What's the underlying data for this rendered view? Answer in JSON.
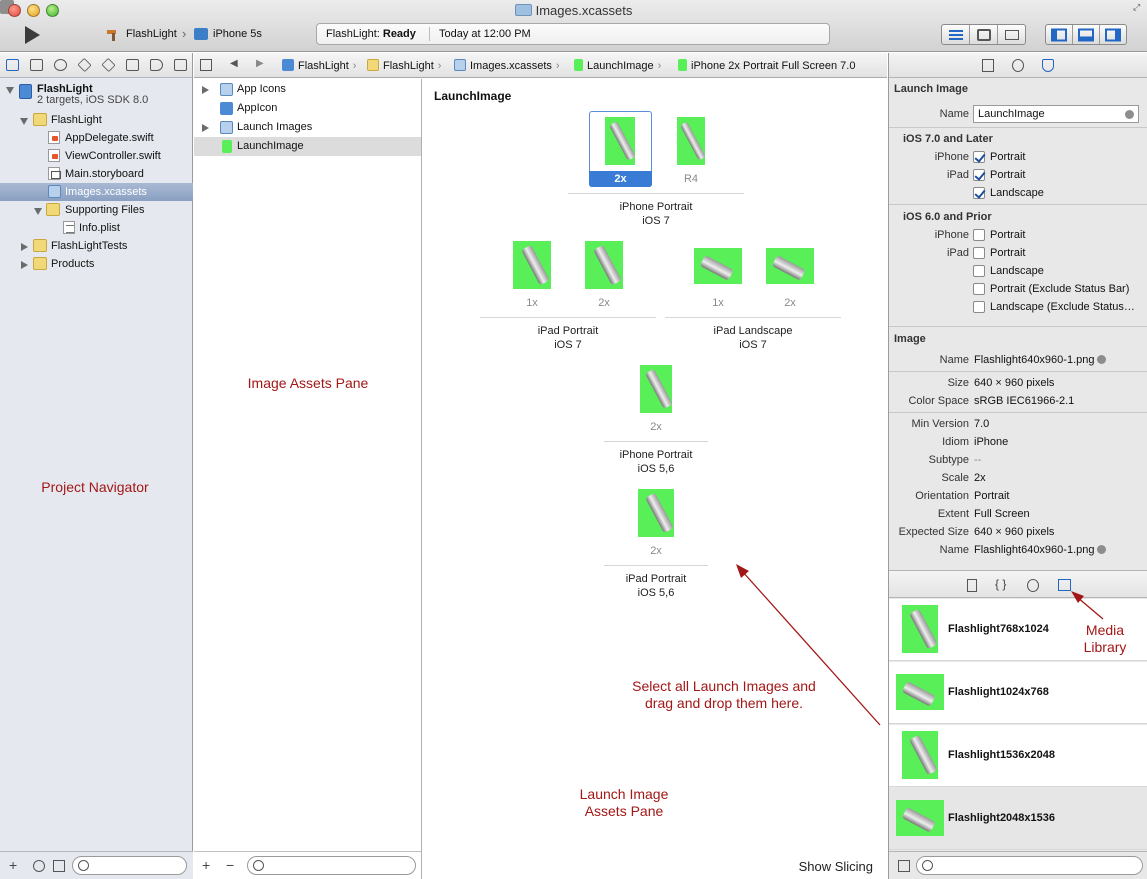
{
  "window": {
    "title": "Images.xcassets"
  },
  "toolbar": {
    "scheme": "FlashLight",
    "device": "iPhone 5s",
    "status_app": "FlashLight:",
    "status_state": "Ready",
    "status_time": "Today at 12:00 PM"
  },
  "navigator": {
    "items": [
      {
        "label": "FlashLight",
        "icon": "project-icon"
      },
      {
        "label": "2 targets, iOS SDK 8.0"
      },
      {
        "label": "FlashLight",
        "icon": "folder-icon"
      },
      {
        "label": "AppDelegate.swift",
        "icon": "swift-file-icon"
      },
      {
        "label": "ViewController.swift",
        "icon": "swift-file-icon"
      },
      {
        "label": "Main.storyboard",
        "icon": "storyboard-icon"
      },
      {
        "label": "Images.xcassets",
        "icon": "asset-catalog-icon"
      },
      {
        "label": "Supporting Files",
        "icon": "folder-icon"
      },
      {
        "label": "Info.plist",
        "icon": "plist-icon"
      },
      {
        "label": "FlashLightTests",
        "icon": "folder-icon"
      },
      {
        "label": "Products",
        "icon": "folder-icon"
      }
    ]
  },
  "jumpbar": {
    "crumbs": [
      "FlashLight",
      "FlashLight",
      "Images.xcassets",
      "LaunchImage",
      "iPhone 2x Portrait Full Screen 7.0"
    ]
  },
  "sets": {
    "items": [
      "App Icons",
      "AppIcon",
      "Launch Images",
      "LaunchImage"
    ]
  },
  "detail": {
    "title": "LaunchImage",
    "slots": {
      "iphone7_2x": "2x",
      "iphone7_r4": "R4",
      "ipad_portrait_1x": "1x",
      "ipad_portrait_2x": "2x",
      "ipad_landscape_1x": "1x",
      "ipad_landscape_2x": "2x",
      "iphone56_2x": "2x",
      "ipad56_2x": "2x"
    },
    "groups": {
      "iphone7": [
        "iPhone Portrait",
        "iOS 7"
      ],
      "ipad_portrait": [
        "iPad Portrait",
        "iOS 7"
      ],
      "ipad_landscape": [
        "iPad Landscape",
        "iOS 7"
      ],
      "iphone56": [
        "iPhone Portrait",
        "iOS 5,6"
      ],
      "ipad56": [
        "iPad Portrait",
        "iOS 5,6"
      ]
    },
    "show_slicing": "Show Slicing"
  },
  "annotations": {
    "image_assets": "Image Assets Pane",
    "project_navigator": "Project Navigator",
    "drag_drop": [
      "Select all Launch Images and",
      "drag and drop them here."
    ],
    "launch_pane": [
      "Launch Image",
      "Assets Pane"
    ],
    "media_library": [
      "Media",
      "Library"
    ]
  },
  "inspector": {
    "launch": {
      "header": "Launch Image",
      "name_label": "Name",
      "name_value": "LaunchImage"
    },
    "ios7": {
      "header": "iOS 7.0 and Later",
      "iphone_label": "iPhone",
      "ipad_label": "iPad",
      "iphone_portrait": {
        "label": "Portrait",
        "checked": true
      },
      "ipad_portrait": {
        "label": "Portrait",
        "checked": true
      },
      "ipad_landscape": {
        "label": "Landscape",
        "checked": true
      }
    },
    "ios6": {
      "header": "iOS 6.0 and Prior",
      "iphone_label": "iPhone",
      "ipad_label": "iPad",
      "options": [
        {
          "label": "Portrait",
          "checked": false
        },
        {
          "label": "Portrait",
          "checked": false
        },
        {
          "label": "Landscape",
          "checked": false
        },
        {
          "label": "Portrait (Exclude Status Bar)",
          "checked": false
        },
        {
          "label": "Landscape (Exclude Status…",
          "checked": false
        }
      ]
    },
    "image": {
      "header": "Image",
      "props": [
        {
          "label": "Name",
          "value": "Flashlight640x960-1.png"
        },
        {
          "label": "Size",
          "value": "640 × 960 pixels"
        },
        {
          "label": "Color Space",
          "value": "sRGB IEC61966-2.1"
        },
        {
          "label": "Min Version",
          "value": "7.0"
        },
        {
          "label": "Idiom",
          "value": "iPhone"
        },
        {
          "label": "Subtype",
          "value": "--"
        },
        {
          "label": "Scale",
          "value": "2x"
        },
        {
          "label": "Orientation",
          "value": "Portrait"
        },
        {
          "label": "Extent",
          "value": "Full Screen"
        },
        {
          "label": "Expected Size",
          "value": "640 × 960 pixels"
        },
        {
          "label": "Name",
          "value": "Flashlight640x960-1.png"
        }
      ]
    }
  },
  "library": {
    "items": [
      "Flashlight768x1024",
      "Flashlight1024x768",
      "Flashlight1536x2048",
      "Flashlight2048x1536"
    ]
  }
}
